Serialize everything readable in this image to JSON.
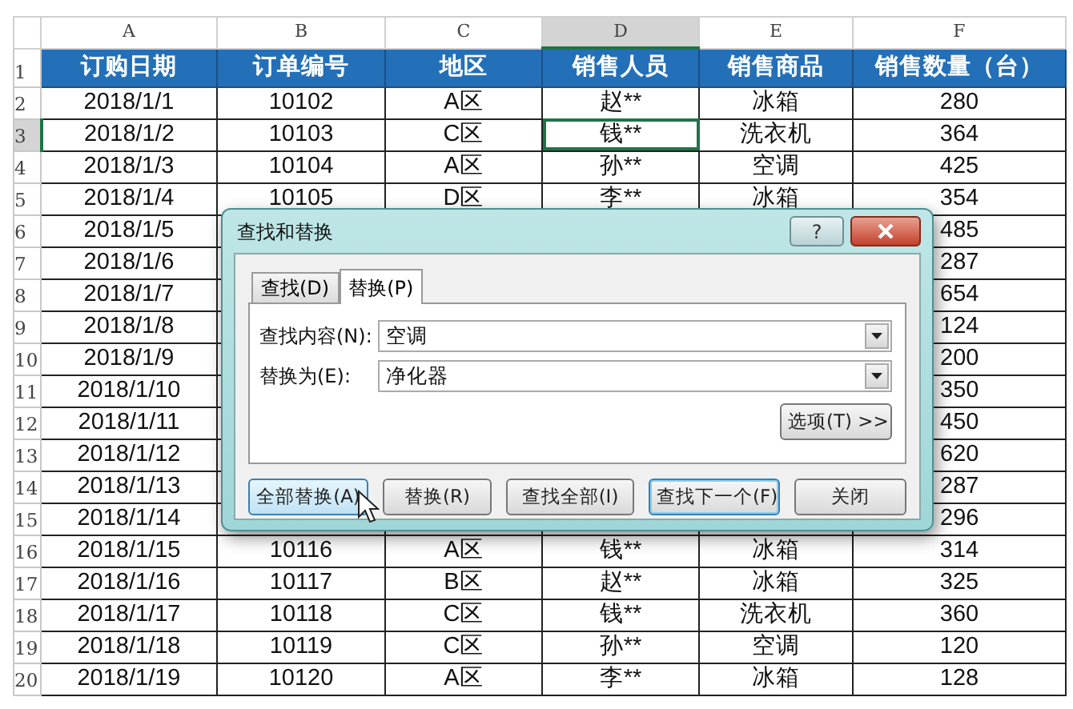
{
  "columns": [
    {
      "label": "A",
      "selected": false
    },
    {
      "label": "B",
      "selected": false
    },
    {
      "label": "C",
      "selected": false
    },
    {
      "label": "D",
      "selected": true
    },
    {
      "label": "E",
      "selected": false
    },
    {
      "label": "F",
      "selected": false
    }
  ],
  "header_row": {
    "number": "1",
    "cells": [
      "订购日期",
      "订单编号",
      "地区",
      "销售人员",
      "销售商品",
      "销售数量（台）"
    ]
  },
  "rows": [
    {
      "number": "2",
      "selected": false,
      "covered": false,
      "cells": [
        "2018/1/1",
        "10102",
        "A区",
        "赵**",
        "冰箱",
        "280"
      ]
    },
    {
      "number": "3",
      "selected": true,
      "covered": false,
      "cells": [
        "2018/1/2",
        "10103",
        "C区",
        "钱**",
        "洗衣机",
        "364"
      ]
    },
    {
      "number": "4",
      "selected": false,
      "covered": false,
      "cells": [
        "2018/1/3",
        "10104",
        "A区",
        "孙**",
        "空调",
        "425"
      ]
    },
    {
      "number": "5",
      "selected": false,
      "covered": false,
      "cells": [
        "2018/1/4",
        "10105",
        "D区",
        "李**",
        "冰箱",
        "354"
      ]
    },
    {
      "number": "6",
      "selected": false,
      "covered": true,
      "cells": [
        "2018/1/5",
        "485"
      ]
    },
    {
      "number": "7",
      "selected": false,
      "covered": true,
      "cells": [
        "2018/1/6",
        "287"
      ]
    },
    {
      "number": "8",
      "selected": false,
      "covered": true,
      "cells": [
        "2018/1/7",
        "654"
      ]
    },
    {
      "number": "9",
      "selected": false,
      "covered": true,
      "cells": [
        "2018/1/8",
        "124"
      ]
    },
    {
      "number": "10",
      "selected": false,
      "covered": true,
      "cells": [
        "2018/1/9",
        "200"
      ]
    },
    {
      "number": "11",
      "selected": false,
      "covered": true,
      "cells": [
        "2018/1/10",
        "350"
      ]
    },
    {
      "number": "12",
      "selected": false,
      "covered": true,
      "cells": [
        "2018/1/11",
        "450"
      ]
    },
    {
      "number": "13",
      "selected": false,
      "covered": true,
      "cells": [
        "2018/1/12",
        "620"
      ]
    },
    {
      "number": "14",
      "selected": false,
      "covered": true,
      "cells": [
        "2018/1/13",
        "287"
      ]
    },
    {
      "number": "15",
      "selected": false,
      "covered": true,
      "cells": [
        "2018/1/14",
        "296"
      ]
    },
    {
      "number": "16",
      "selected": false,
      "covered": false,
      "cells": [
        "2018/1/15",
        "10116",
        "A区",
        "钱**",
        "冰箱",
        "314"
      ]
    },
    {
      "number": "17",
      "selected": false,
      "covered": false,
      "cells": [
        "2018/1/16",
        "10117",
        "B区",
        "赵**",
        "冰箱",
        "325"
      ]
    },
    {
      "number": "18",
      "selected": false,
      "covered": false,
      "cells": [
        "2018/1/17",
        "10118",
        "C区",
        "钱**",
        "洗衣机",
        "360"
      ]
    },
    {
      "number": "19",
      "selected": false,
      "covered": false,
      "cells": [
        "2018/1/18",
        "10119",
        "C区",
        "孙**",
        "空调",
        "120"
      ]
    },
    {
      "number": "20",
      "selected": false,
      "covered": false,
      "cells": [
        "2018/1/19",
        "10120",
        "A区",
        "李**",
        "冰箱",
        "128"
      ]
    }
  ],
  "dialog": {
    "title": "查找和替换",
    "help": "?",
    "tabs": [
      {
        "label": "查找(D)",
        "selected": false
      },
      {
        "label": "替换(P)",
        "selected": true
      }
    ],
    "fields": [
      {
        "label": "查找内容(N):",
        "value": "空调"
      },
      {
        "label": "替换为(E):",
        "value": "净化器"
      }
    ],
    "options_button": "选项(T) >>",
    "buttons": [
      {
        "label": "全部替换(A)",
        "hovered": true,
        "default": false
      },
      {
        "label": "替换(R)",
        "hovered": false,
        "default": false
      },
      {
        "label": "查找全部(I)",
        "hovered": false,
        "default": false
      },
      {
        "label": "查找下一个(F)",
        "hovered": false,
        "default": true
      },
      {
        "label": "关闭",
        "hovered": false,
        "default": false
      }
    ]
  }
}
